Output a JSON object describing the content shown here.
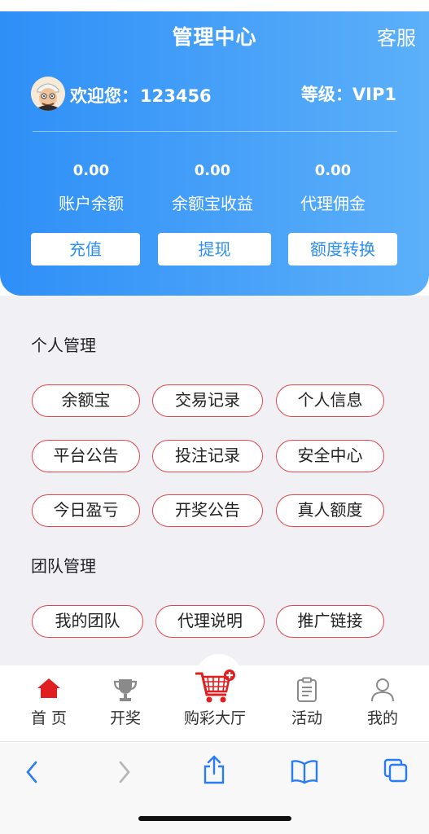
{
  "header": {
    "title": "管理中心",
    "service": "客服",
    "welcome_label": "欢迎您：",
    "username": "123456",
    "level": "等级：VIP1",
    "stats": [
      {
        "value": "0.00",
        "label": "账户余额"
      },
      {
        "value": "0.00",
        "label": "余额宝收益"
      },
      {
        "value": "0.00",
        "label": "代理佣金"
      }
    ],
    "buttons": [
      "充值",
      "提现",
      "额度转换"
    ]
  },
  "personal": {
    "title": "个人管理",
    "items": [
      "余额宝",
      "交易记录",
      "个人信息",
      "平台公告",
      "投注记录",
      "安全中心",
      "今日盈亏",
      "开奖公告",
      "真人额度"
    ]
  },
  "team": {
    "title": "团队管理",
    "items": [
      "我的团队",
      "代理说明",
      "推广链接"
    ]
  },
  "tabbar": {
    "items": [
      {
        "label": "首 页",
        "icon": "home-icon"
      },
      {
        "label": "开奖",
        "icon": "trophy-icon"
      },
      {
        "label": "购彩大厅",
        "icon": "cart-icon"
      },
      {
        "label": "活动",
        "icon": "clipboard-icon"
      },
      {
        "label": "我的",
        "icon": "person-icon"
      }
    ]
  },
  "colors": {
    "header_start": "#2e8ff7",
    "header_end": "#5cb0fa",
    "accent_red": "#e0464a",
    "page_bg": "#f1f1f5"
  }
}
